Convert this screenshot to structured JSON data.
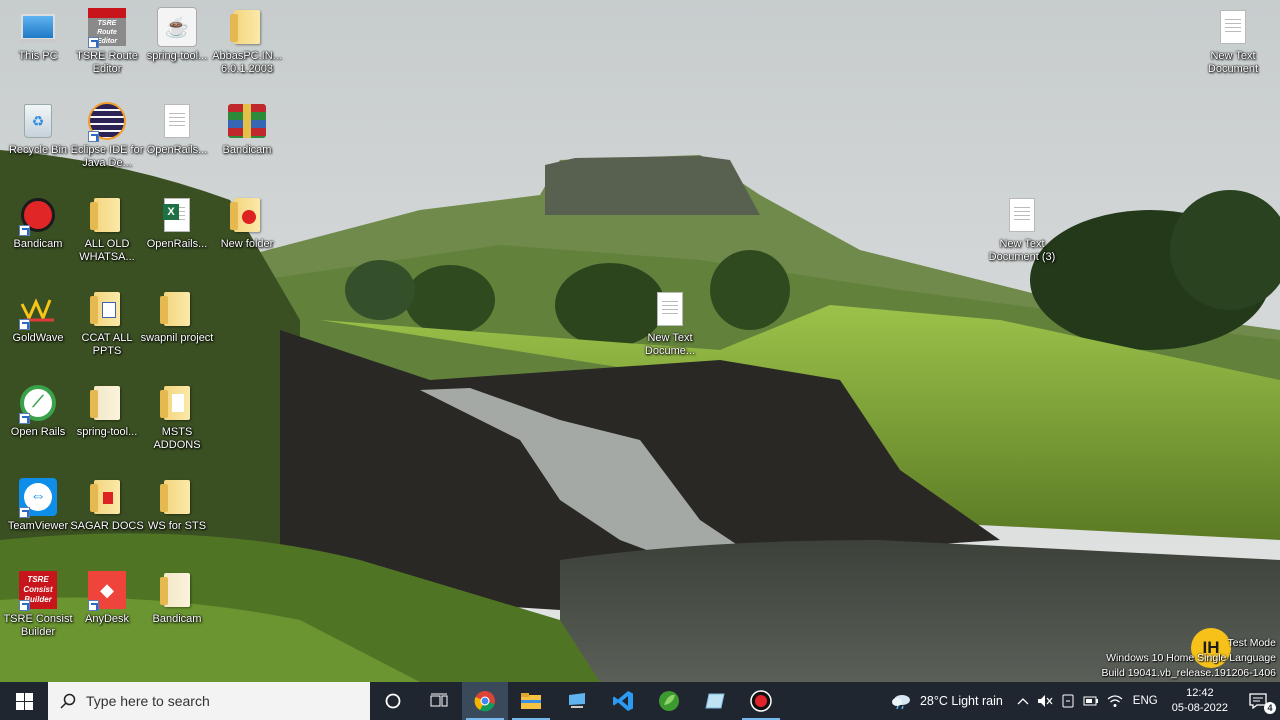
{
  "desktop": {
    "icons": [
      {
        "label": "This PC"
      },
      {
        "label": "TSRE Route Editor"
      },
      {
        "label": "spring-tool..."
      },
      {
        "label": "AbbasPC.IN... 6.0.1.2003"
      },
      {
        "label": "Recycle Bin"
      },
      {
        "label": "Eclipse IDE for Java De..."
      },
      {
        "label": "OpenRails..."
      },
      {
        "label": "Bandicam"
      },
      {
        "label": "Bandicam"
      },
      {
        "label": "ALL OLD WHATSA..."
      },
      {
        "label": "OpenRails..."
      },
      {
        "label": "New folder"
      },
      {
        "label": "GoldWave"
      },
      {
        "label": "CCAT ALL PPTS"
      },
      {
        "label": "swapnil project"
      },
      {
        "label": "Open Rails"
      },
      {
        "label": "spring-tool..."
      },
      {
        "label": "MSTS ADDONS"
      },
      {
        "label": "TeamViewer"
      },
      {
        "label": "SAGAR DOCS"
      },
      {
        "label": "WS for STS"
      },
      {
        "label": "TSRE Consist Builder"
      },
      {
        "label": "AnyDesk"
      },
      {
        "label": "Bandicam"
      },
      {
        "label": "New Text Document"
      },
      {
        "label": "New Text Document (3)"
      },
      {
        "label": "New Text Docume..."
      }
    ],
    "icon_badges": {
      "tsre_route": "TSRE Route Editor",
      "tsre_consist": "TSRE Consist Builder",
      "excel": "X"
    }
  },
  "watermark": {
    "line1": "Test Mode",
    "line2": "Windows 10 Home Single Language",
    "line3": "Build 19041.vb_release.191206-1406",
    "logo_text": "IH"
  },
  "taskbar": {
    "search_placeholder": "Type here to search",
    "weather": "28°C  Light rain",
    "language": "ENG",
    "time": "12:42",
    "date": "05-08-2022",
    "notification_count": "4",
    "pinned": [
      "chrome-icon",
      "file-explorer-icon",
      "remote-desktop-icon",
      "vscode-icon",
      "spring-tool-suite-icon",
      "notepad-icon",
      "recorder-icon"
    ]
  },
  "colors": {
    "taskbar_bg": "#1f2630",
    "accent": "#76b9ed",
    "watermark_logo": "#f6c21a"
  }
}
